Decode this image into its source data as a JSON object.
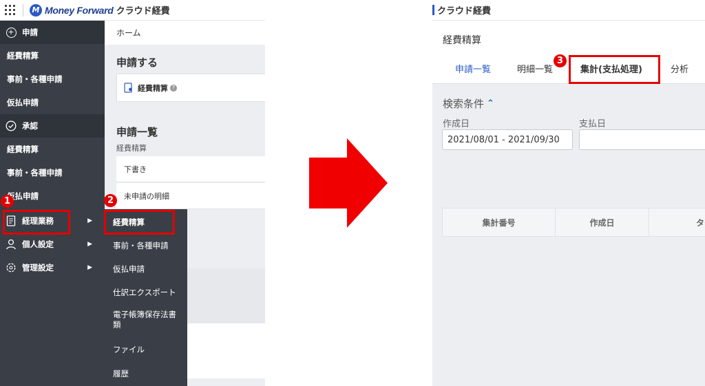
{
  "left": {
    "brand": "Money Forward",
    "brand_logo_letter": "M",
    "product": "クラウド経費",
    "sidebar": [
      {
        "label": "申請",
        "icon": "plus-circle-icon",
        "type": "section"
      },
      {
        "label": "経費精算",
        "type": "sub"
      },
      {
        "label": "事前・各種申請",
        "type": "sub"
      },
      {
        "label": "仮払申請",
        "type": "sub"
      },
      {
        "label": "承認",
        "icon": "check-circle-icon",
        "type": "section"
      },
      {
        "label": "経費精算",
        "type": "sub"
      },
      {
        "label": "事前・各種申請",
        "type": "sub"
      },
      {
        "label": "仮払申請",
        "type": "sub"
      },
      {
        "label": "経理業務",
        "icon": "document-icon",
        "type": "menu"
      },
      {
        "label": "個人設定",
        "icon": "person-icon",
        "type": "menu"
      },
      {
        "label": "管理設定",
        "icon": "gear-icon",
        "type": "menu"
      }
    ],
    "main": {
      "breadcrumb": "ホーム",
      "apply_heading": "申請する",
      "apply_card_label": "経費精算",
      "list_heading": "申請一覧",
      "list_subheading": "経費精算",
      "rows": [
        "下書き",
        "未申請の明細"
      ]
    },
    "flyout": [
      "経費精算",
      "事前・各種申請",
      "仮払申請",
      "仕訳エクスポート",
      "電子帳簿保存法書類",
      "ファイル",
      "履歴"
    ]
  },
  "right": {
    "product": "クラウド経費",
    "page_title": "経費精算",
    "tabs": [
      {
        "label": "申請一覧",
        "active": true
      },
      {
        "label": "明細一覧",
        "active": false
      },
      {
        "label": "集計(支払処理)",
        "active": false
      },
      {
        "label": "分析",
        "active": false
      }
    ],
    "search_title": "検索条件",
    "filters": [
      {
        "label": "作成日",
        "value": "2021/08/01 - 2021/09/30"
      },
      {
        "label": "支払日",
        "value": ""
      }
    ],
    "table_headers": [
      "集計番号",
      "作成日",
      "タイ"
    ]
  },
  "annotations": {
    "badges": [
      "1",
      "2",
      "3"
    ],
    "highlight_color": "#e50000"
  },
  "colors": {
    "sidebar_bg": "#3a3f47",
    "accent": "#2a5ac6",
    "highlight": "#e50000"
  }
}
